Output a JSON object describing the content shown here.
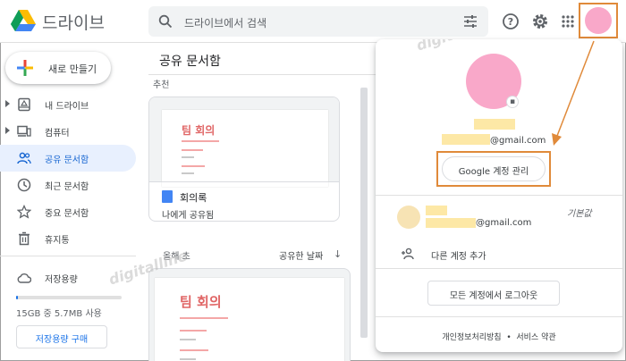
{
  "app": {
    "title": "드라이브",
    "logo_icon": "google-drive-logo"
  },
  "search": {
    "placeholder": "드라이브에서 검색"
  },
  "header_icons": [
    "help-icon",
    "settings-icon",
    "apps-grid-icon"
  ],
  "sidebar": {
    "new_button": "새로 만들기",
    "items": [
      {
        "label": "내 드라이브",
        "icon": "my-drive-icon",
        "expandable": true,
        "active": false
      },
      {
        "label": "컴퓨터",
        "icon": "computer-icon",
        "expandable": true,
        "active": false
      },
      {
        "label": "공유 문서함",
        "icon": "shared-icon",
        "expandable": false,
        "active": true
      },
      {
        "label": "최근 문서함",
        "icon": "clock-icon",
        "expandable": false,
        "active": false
      },
      {
        "label": "중요 문서함",
        "icon": "star-icon",
        "expandable": false,
        "active": false
      },
      {
        "label": "휴지통",
        "icon": "trash-icon",
        "expandable": false,
        "active": false
      }
    ],
    "storage": {
      "label": "저장용량",
      "usage_text": "15GB 중 5.7MB 사용",
      "used_fraction": 0.004,
      "buy_button": "저장용량 구매"
    }
  },
  "main": {
    "title": "공유 문서함",
    "suggested_label": "추천",
    "file_card": {
      "thumb_title": "팀 회의",
      "name": "회의록",
      "subtitle": "나에게 공유됨"
    },
    "this_year_label": "올해 초",
    "sort_label": "공유한 날짜",
    "sort_arrow": "↓",
    "thumb2_title": "팀 회의"
  },
  "watermark": "digitalline",
  "account_popup": {
    "primary_email_suffix": "@gmail.com",
    "manage_button": "Google 계정 관리",
    "secondary_email_suffix": "@gmail.com",
    "default_label": "기본값",
    "add_account": "다른 계정 추가",
    "logout_button": "모든 계정에서 로그아웃",
    "footer": {
      "privacy": "개인정보처리방침",
      "dot": "•",
      "terms": "서비스 약관"
    }
  },
  "colors": {
    "accent": "#1a73e8",
    "active_nav_bg": "#e8f0fe",
    "highlight": "#e08a3a",
    "avatar": "#f9a8c9"
  }
}
